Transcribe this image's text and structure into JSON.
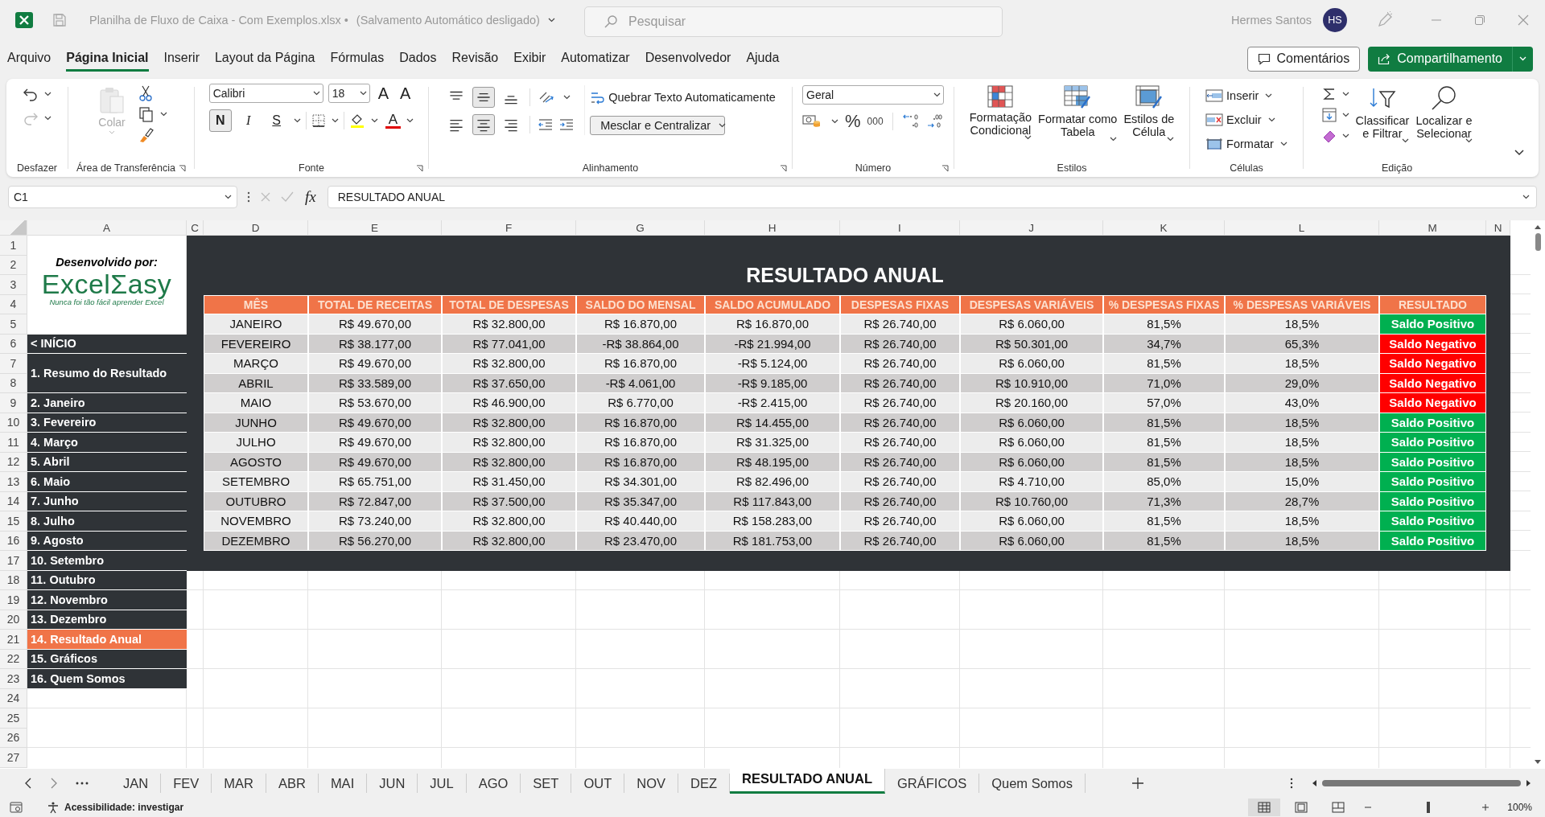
{
  "window": {
    "title": "Planilha de Fluxo de Caixa - Com Exemplos.xlsx  •",
    "autosave": "(Salvamento Automático desligado)",
    "search_placeholder": "Pesquisar",
    "user": "Hermes Santos",
    "avatar": "HS"
  },
  "menu": [
    {
      "label": "Arquivo",
      "selected": false
    },
    {
      "label": "Página Inicial",
      "selected": true
    },
    {
      "label": "Inserir",
      "selected": false
    },
    {
      "label": "Layout da Página",
      "selected": false
    },
    {
      "label": "Fórmulas",
      "selected": false
    },
    {
      "label": "Dados",
      "selected": false
    },
    {
      "label": "Revisão",
      "selected": false
    },
    {
      "label": "Exibir",
      "selected": false
    },
    {
      "label": "Automatizar",
      "selected": false
    },
    {
      "label": "Desenvolvedor",
      "selected": false
    },
    {
      "label": "Ajuda",
      "selected": false
    }
  ],
  "actions": {
    "comments": "Comentários",
    "share": "Compartilhamento"
  },
  "ribbon": {
    "undo": {
      "label": "Desfazer",
      "redo_disabled": true
    },
    "clipboard": {
      "paste": "Colar",
      "paste_disabled": true,
      "label": "Área de Transferência"
    },
    "font": {
      "name": "Calibri",
      "size": "18",
      "grow": "A",
      "shrink": "A",
      "bold": "N",
      "bold_on": true,
      "italic": "I",
      "underline": "S",
      "color_letter": "A",
      "label": "Fonte"
    },
    "alignment": {
      "vertical": [
        {
          "kind": "top",
          "selected": false
        },
        {
          "kind": "middle",
          "selected": true
        },
        {
          "kind": "bottom",
          "selected": false
        }
      ],
      "horizontal": [
        {
          "kind": "left",
          "selected": false
        },
        {
          "kind": "center",
          "selected": true
        },
        {
          "kind": "right",
          "selected": false
        }
      ],
      "wrap": "Quebrar Texto Automaticamente",
      "merge": "Mesclar e Centralizar",
      "label": "Alinhamento"
    },
    "number": {
      "format": "Geral",
      "percent": "%",
      "thousands": "000",
      "label": "Número"
    },
    "styles": {
      "items": [
        {
          "kind": "conditional",
          "label": "Formatação\nCondicional"
        },
        {
          "kind": "table",
          "label": "Formatar como\nTabela"
        },
        {
          "kind": "cell",
          "label": "Estilos de\nCélula"
        }
      ],
      "label": "Estilos"
    },
    "cells": {
      "items": [
        {
          "kind": "insert",
          "label": "Inserir"
        },
        {
          "kind": "delete",
          "label": "Excluir"
        },
        {
          "kind": "format",
          "label": "Formatar"
        }
      ],
      "label": "Células"
    },
    "editing": {
      "items": [
        {
          "kind": "sort",
          "label": "Classificar\ne Filtrar"
        },
        {
          "kind": "find",
          "label": "Localizar e\nSelecionar"
        }
      ],
      "label": "Edição"
    }
  },
  "formula_bar": {
    "name_box": "C1",
    "fx": "fx",
    "value": "RESULTADO ANUAL"
  },
  "columns": [
    "A",
    "C",
    "D",
    "E",
    "F",
    "G",
    "H",
    "I",
    "J",
    "K",
    "L",
    "M",
    "N"
  ],
  "row_numbers": [
    "1",
    "2",
    "3",
    "4",
    "5",
    "6",
    "7",
    "8",
    "9",
    "10",
    "11",
    "12",
    "13",
    "14",
    "15",
    "16",
    "17",
    "18",
    "19",
    "20",
    "21",
    "22",
    "23",
    "24",
    "25",
    "26",
    "27"
  ],
  "sidebar": {
    "credit": "Desenvolvido por:",
    "logo": "ExcelΣasy",
    "tagline": "Nunca foi tão fácil aprender Excel",
    "items": [
      {
        "label": "< INÍCIO",
        "kind": "single",
        "selected": false
      },
      {
        "label": "1. Resumo do Resultado",
        "kind": "tall",
        "selected": false
      },
      {
        "label": "2. Janeiro",
        "kind": "single",
        "selected": false
      },
      {
        "label": "3. Fevereiro",
        "kind": "single",
        "selected": false
      },
      {
        "label": "4. Março",
        "kind": "single",
        "selected": false
      },
      {
        "label": "5. Abril",
        "kind": "single",
        "selected": false
      },
      {
        "label": "6. Maio",
        "kind": "single",
        "selected": false
      },
      {
        "label": "7. Junho",
        "kind": "single",
        "selected": false
      },
      {
        "label": "8. Julho",
        "kind": "single",
        "selected": false
      },
      {
        "label": "9. Agosto",
        "kind": "single",
        "selected": false
      },
      {
        "label": "10. Setembro",
        "kind": "single",
        "selected": false
      },
      {
        "label": "11. Outubro",
        "kind": "single",
        "selected": false
      },
      {
        "label": "12. Novembro",
        "kind": "single",
        "selected": false
      },
      {
        "label": "13. Dezembro",
        "kind": "single",
        "selected": false
      },
      {
        "label": "14. Resultado Anual",
        "kind": "single",
        "selected": true
      },
      {
        "label": "15. Gráficos",
        "kind": "single",
        "selected": false
      },
      {
        "label": "16. Quem Somos",
        "kind": "single",
        "selected": false
      }
    ]
  },
  "report": {
    "title": "RESULTADO ANUAL",
    "columns": [
      "MÊS",
      "TOTAL DE RECEITAS",
      "TOTAL DE DESPESAS",
      "SALDO DO MENSAL",
      "SALDO ACUMULADO",
      "DESPESAS FIXAS",
      "DESPESAS VARIÁVEIS",
      "% DESPESAS FIXAS",
      "% DESPESAS VARIÁVEIS",
      "RESULTADO"
    ],
    "rows": [
      {
        "cells": [
          "JANEIRO",
          "R$ 49.670,00",
          "R$ 32.800,00",
          "R$ 16.870,00",
          "R$ 16.870,00",
          "R$ 26.740,00",
          "R$ 6.060,00",
          "81,5%",
          "18,5%"
        ],
        "result": {
          "text": "Saldo Positivo",
          "kind": "positive"
        }
      },
      {
        "cells": [
          "FEVEREIRO",
          "R$ 38.177,00",
          "R$ 77.041,00",
          "-R$ 38.864,00",
          "-R$ 21.994,00",
          "R$ 26.740,00",
          "R$ 50.301,00",
          "34,7%",
          "65,3%"
        ],
        "result": {
          "text": "Saldo Negativo",
          "kind": "negative"
        }
      },
      {
        "cells": [
          "MARÇO",
          "R$ 49.670,00",
          "R$ 32.800,00",
          "R$ 16.870,00",
          "-R$ 5.124,00",
          "R$ 26.740,00",
          "R$ 6.060,00",
          "81,5%",
          "18,5%"
        ],
        "result": {
          "text": "Saldo Negativo",
          "kind": "negative"
        }
      },
      {
        "cells": [
          "ABRIL",
          "R$ 33.589,00",
          "R$ 37.650,00",
          "-R$ 4.061,00",
          "-R$ 9.185,00",
          "R$ 26.740,00",
          "R$ 10.910,00",
          "71,0%",
          "29,0%"
        ],
        "result": {
          "text": "Saldo Negativo",
          "kind": "negative"
        }
      },
      {
        "cells": [
          "MAIO",
          "R$ 53.670,00",
          "R$ 46.900,00",
          "R$ 6.770,00",
          "-R$ 2.415,00",
          "R$ 26.740,00",
          "R$ 20.160,00",
          "57,0%",
          "43,0%"
        ],
        "result": {
          "text": "Saldo Negativo",
          "kind": "negative"
        }
      },
      {
        "cells": [
          "JUNHO",
          "R$ 49.670,00",
          "R$ 32.800,00",
          "R$ 16.870,00",
          "R$ 14.455,00",
          "R$ 26.740,00",
          "R$ 6.060,00",
          "81,5%",
          "18,5%"
        ],
        "result": {
          "text": "Saldo Positivo",
          "kind": "positive"
        }
      },
      {
        "cells": [
          "JULHO",
          "R$ 49.670,00",
          "R$ 32.800,00",
          "R$ 16.870,00",
          "R$ 31.325,00",
          "R$ 26.740,00",
          "R$ 6.060,00",
          "81,5%",
          "18,5%"
        ],
        "result": {
          "text": "Saldo Positivo",
          "kind": "positive"
        }
      },
      {
        "cells": [
          "AGOSTO",
          "R$ 49.670,00",
          "R$ 32.800,00",
          "R$ 16.870,00",
          "R$ 48.195,00",
          "R$ 26.740,00",
          "R$ 6.060,00",
          "81,5%",
          "18,5%"
        ],
        "result": {
          "text": "Saldo Positivo",
          "kind": "positive"
        }
      },
      {
        "cells": [
          "SETEMBRO",
          "R$ 65.751,00",
          "R$ 31.450,00",
          "R$ 34.301,00",
          "R$ 82.496,00",
          "R$ 26.740,00",
          "R$ 4.710,00",
          "85,0%",
          "15,0%"
        ],
        "result": {
          "text": "Saldo Positivo",
          "kind": "positive"
        }
      },
      {
        "cells": [
          "OUTUBRO",
          "R$ 72.847,00",
          "R$ 37.500,00",
          "R$ 35.347,00",
          "R$ 117.843,00",
          "R$ 26.740,00",
          "R$ 10.760,00",
          "71,3%",
          "28,7%"
        ],
        "result": {
          "text": "Saldo Positivo",
          "kind": "positive"
        }
      },
      {
        "cells": [
          "NOVEMBRO",
          "R$ 73.240,00",
          "R$ 32.800,00",
          "R$ 40.440,00",
          "R$ 158.283,00",
          "R$ 26.740,00",
          "R$ 6.060,00",
          "81,5%",
          "18,5%"
        ],
        "result": {
          "text": "Saldo Positivo",
          "kind": "positive"
        }
      },
      {
        "cells": [
          "DEZEMBRO",
          "R$ 56.270,00",
          "R$ 32.800,00",
          "R$ 23.470,00",
          "R$ 181.753,00",
          "R$ 26.740,00",
          "R$ 6.060,00",
          "81,5%",
          "18,5%"
        ],
        "result": {
          "text": "Saldo Positivo",
          "kind": "positive"
        }
      }
    ]
  },
  "sheet_tabs": [
    {
      "label": "JAN",
      "selected": false
    },
    {
      "label": "FEV",
      "selected": false
    },
    {
      "label": "MAR",
      "selected": false
    },
    {
      "label": "ABR",
      "selected": false
    },
    {
      "label": "MAI",
      "selected": false
    },
    {
      "label": "JUN",
      "selected": false
    },
    {
      "label": "JUL",
      "selected": false
    },
    {
      "label": "AGO",
      "selected": false
    },
    {
      "label": "SET",
      "selected": false
    },
    {
      "label": "OUT",
      "selected": false
    },
    {
      "label": "NOV",
      "selected": false
    },
    {
      "label": "DEZ",
      "selected": false
    },
    {
      "label": "RESULTADO ANUAL",
      "selected": true
    },
    {
      "label": "GRÁFICOS",
      "selected": false
    },
    {
      "label": "Quem Somos",
      "selected": false
    }
  ],
  "status_bar": {
    "accessibility": "Acessibilidade: investigar",
    "views": [
      {
        "kind": "normal",
        "selected": true
      },
      {
        "kind": "layout",
        "selected": false
      },
      {
        "kind": "pagebreak",
        "selected": false
      }
    ],
    "zoom_slider": {
      "level": 0.5
    },
    "zoom": "100%"
  }
}
